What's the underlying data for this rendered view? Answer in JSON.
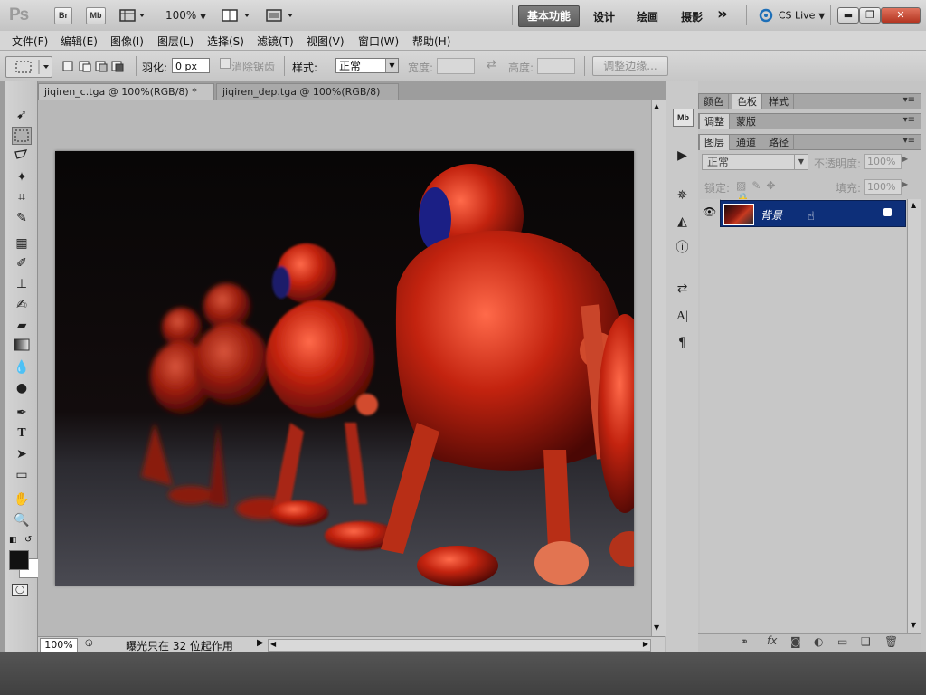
{
  "app": {
    "logo": "Ps",
    "bridge_label": "Br",
    "minibridge_label": "Mb",
    "zoom": "100%",
    "workspaces": [
      "基本功能",
      "设计",
      "绘画",
      "摄影"
    ],
    "more_label": "»",
    "cslive_label": "CS Live"
  },
  "menu": [
    "文件(F)",
    "编辑(E)",
    "图像(I)",
    "图层(L)",
    "选择(S)",
    "滤镜(T)",
    "视图(V)",
    "窗口(W)",
    "帮助(H)"
  ],
  "options": {
    "feather_label": "羽化:",
    "feather_value": "0 px",
    "antialias_label": "消除锯齿",
    "style_label": "样式:",
    "style_value": "正常",
    "width_label": "宽度:",
    "height_label": "高度:",
    "refine_edge_label": "调整边缘..."
  },
  "document_tabs": [
    {
      "title": "jiqiren_c.tga @ 100%(RGB/8) *",
      "active": true
    },
    {
      "title": "jiqiren_dep.tga @ 100%(RGB/8)",
      "active": false
    }
  ],
  "status": {
    "zoom": "100%",
    "message": "曝光只在 32 位起作用"
  },
  "panels": {
    "group1_tabs": [
      "颜色",
      "色板",
      "样式"
    ],
    "group2_tabs": [
      "调整",
      "蒙版"
    ],
    "group3_tabs": [
      "图层",
      "通道",
      "路径"
    ],
    "blend_mode": "正常",
    "opacity_label": "不透明度:",
    "opacity_value": "100%",
    "lock_label": "锁定:",
    "fill_label": "填充:",
    "fill_value": "100%",
    "layer_name": "背景"
  },
  "colors": {
    "active_workspace": "#6a6a6a",
    "selected_layer": "#0d2f79",
    "close_button": "#c0412b"
  }
}
